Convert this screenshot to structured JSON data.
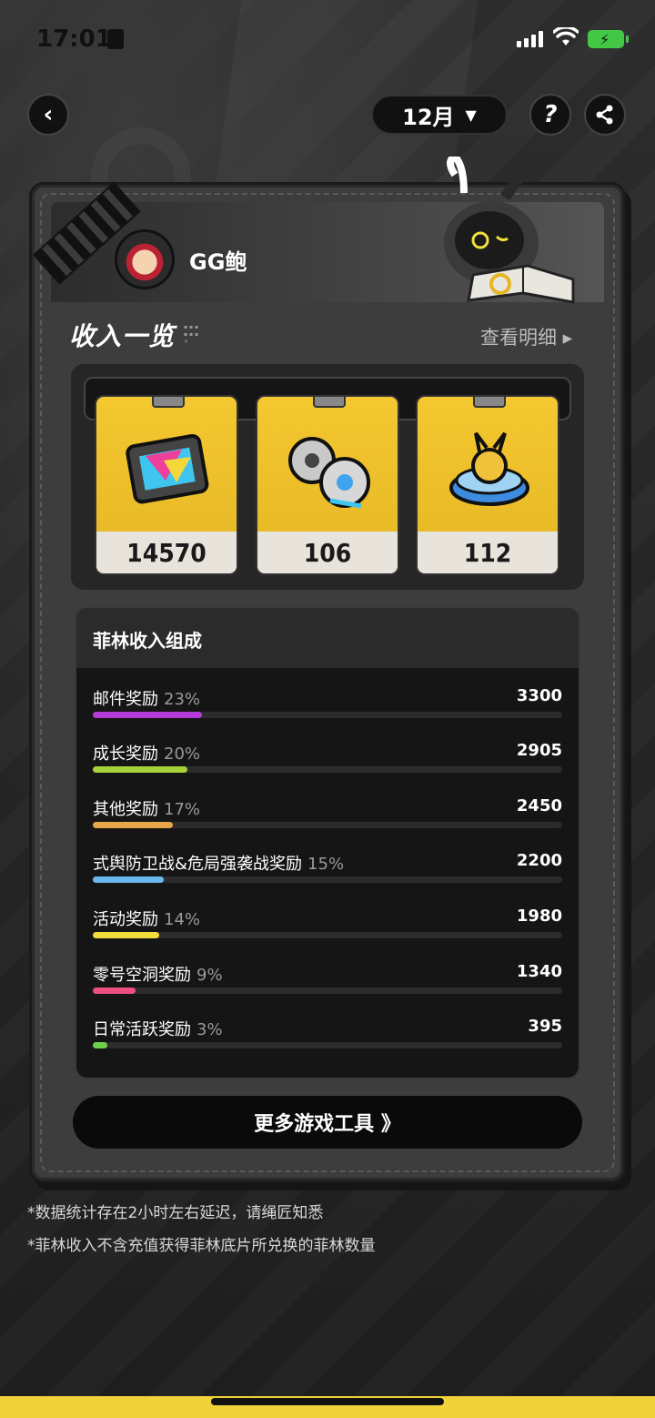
{
  "status_bar": {
    "time": "17:01"
  },
  "header": {
    "month": "12月"
  },
  "profile": {
    "username": "GG鲍"
  },
  "income": {
    "title": "收入一览",
    "detail_link": "查看明细 ▸",
    "rewards": [
      {
        "name": "film-reel-icon",
        "value": "14570"
      },
      {
        "name": "master-tape-icon",
        "value": "106"
      },
      {
        "name": "bangboo-token-icon",
        "value": "112"
      }
    ]
  },
  "breakdown": {
    "title": "菲林收入组成",
    "rows": [
      {
        "label": "邮件奖励",
        "pct": "23%",
        "value": "3300",
        "fraction": 0.23,
        "color": "#b33ad8"
      },
      {
        "label": "成长奖励",
        "pct": "20%",
        "value": "2905",
        "fraction": 0.2,
        "color": "#a6d23a"
      },
      {
        "label": "其他奖励",
        "pct": "17%",
        "value": "2450",
        "fraction": 0.17,
        "color": "#e8a64a"
      },
      {
        "label": "式舆防卫战&危局强袭战奖励",
        "pct": "15%",
        "value": "2200",
        "fraction": 0.15,
        "color": "#6ab8ee"
      },
      {
        "label": "活动奖励",
        "pct": "14%",
        "value": "1980",
        "fraction": 0.14,
        "color": "#f2dd3a"
      },
      {
        "label": "零号空洞奖励",
        "pct": "9%",
        "value": "1340",
        "fraction": 0.09,
        "color": "#ec4f80"
      },
      {
        "label": "日常活跃奖励",
        "pct": "3%",
        "value": "395",
        "fraction": 0.03,
        "color": "#6fcf4a"
      }
    ]
  },
  "more_tools": "更多游戏工具 》",
  "notes": [
    "*数据统计存在2小时左右延迟，请绳匠知悉",
    "*菲林收入不含充值获得菲林底片所兑换的菲林数量"
  ]
}
